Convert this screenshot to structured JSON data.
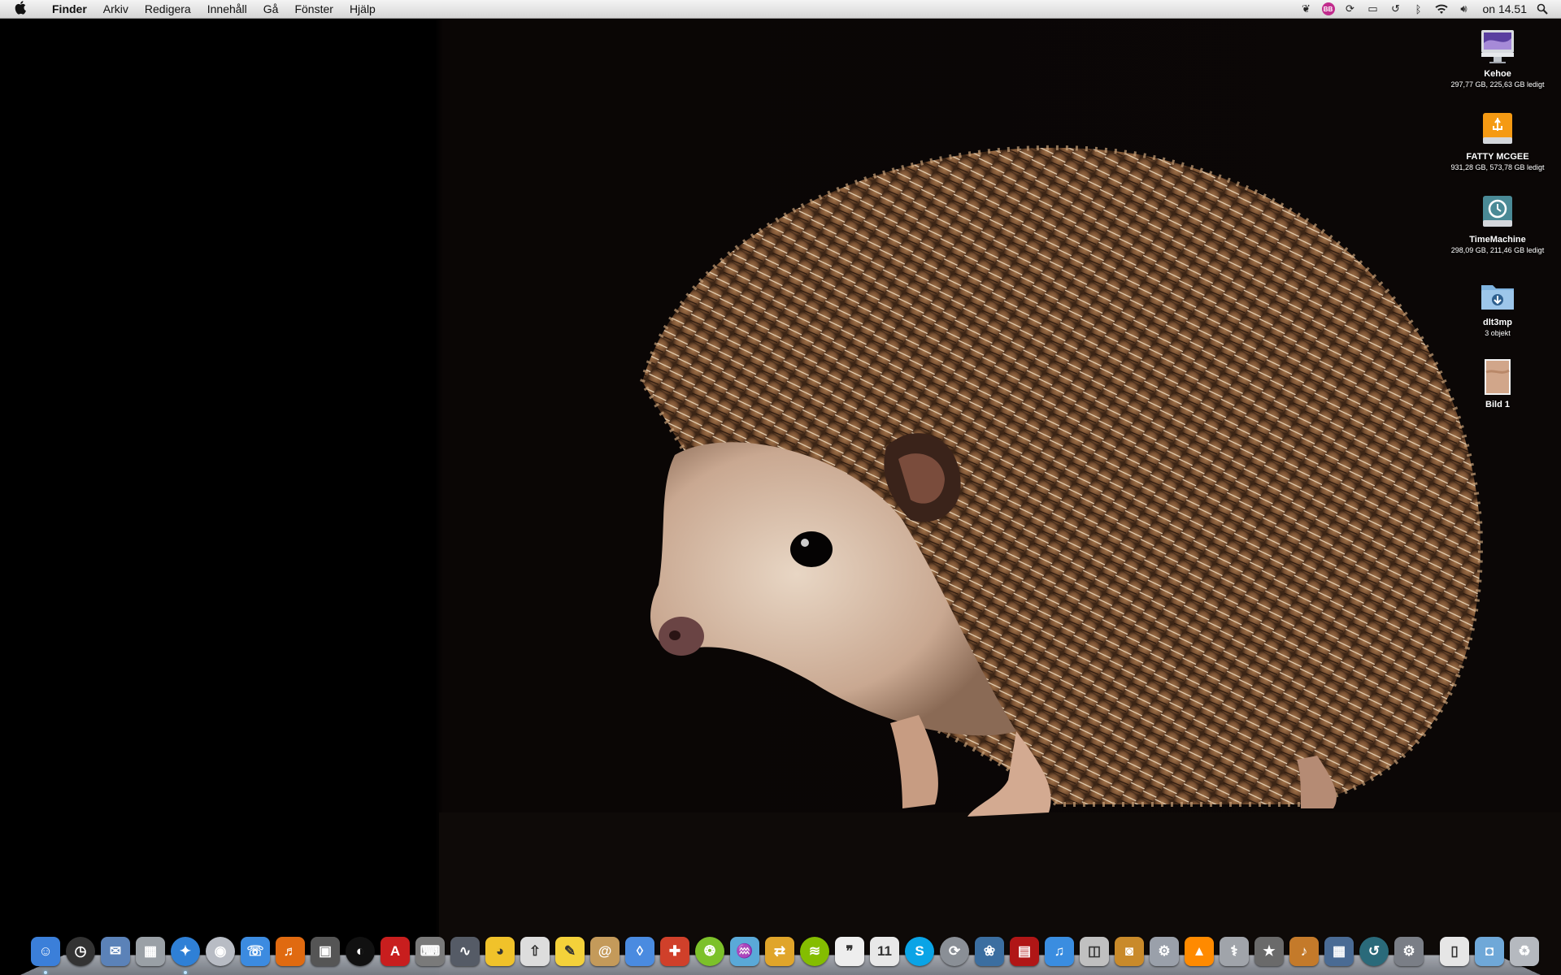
{
  "menubar": {
    "app_name": "Finder",
    "items": [
      "Arkiv",
      "Redigera",
      "Innehåll",
      "Gå",
      "Fönster",
      "Hjälp"
    ],
    "status_badge_text": "BB",
    "clock": "on 14.51"
  },
  "desktop_icons": [
    {
      "name": "Kehoe",
      "info": "297,77 GB, 225,63 GB ledigt",
      "icon": "imac-icon"
    },
    {
      "name": "FATTY MCGEE",
      "info": "931,28 GB, 573,78 GB ledigt",
      "icon": "usb-drive-icon"
    },
    {
      "name": "TimeMachine",
      "info": "298,09 GB, 211,46 GB ledigt",
      "icon": "time-machine-drive-icon"
    },
    {
      "name": "dlt3mp",
      "info": "3 objekt",
      "icon": "downloads-folder-icon"
    },
    {
      "name": "Bild 1",
      "info": "",
      "icon": "image-thumbnail-icon"
    }
  ],
  "dock": {
    "apps": [
      {
        "icon": "finder-icon",
        "glyph": "☺",
        "color": "#3b7fd9"
      },
      {
        "icon": "dashboard-icon",
        "glyph": "◷",
        "color": "#333333"
      },
      {
        "icon": "mail-icon",
        "glyph": "✉",
        "color": "#5b82b8"
      },
      {
        "icon": "calculator-icon",
        "glyph": "▦",
        "color": "#9aa0a6"
      },
      {
        "icon": "safari-icon",
        "glyph": "✦",
        "color": "#2f80d6"
      },
      {
        "icon": "dvd-player-icon",
        "glyph": "◉",
        "color": "#b8bcc4"
      },
      {
        "icon": "ichat-icon",
        "glyph": "☏",
        "color": "#3c8be0"
      },
      {
        "icon": "audacity-icon",
        "glyph": "♬",
        "color": "#e06a10"
      },
      {
        "icon": "film-icon",
        "glyph": "▣",
        "color": "#555555"
      },
      {
        "icon": "ableton-live-icon",
        "glyph": "◐",
        "color": "#111111"
      },
      {
        "icon": "automap-icon",
        "glyph": "A",
        "color": "#c81e1e"
      },
      {
        "icon": "keyboard-icon",
        "glyph": "⌨",
        "color": "#7a7a7a"
      },
      {
        "icon": "wave-icon",
        "glyph": "∿",
        "color": "#555b66"
      },
      {
        "icon": "cyberduck-icon",
        "glyph": "◕",
        "color": "#f0c22a"
      },
      {
        "icon": "flickr-uploadr-icon",
        "glyph": "⇧",
        "color": "#dddddd"
      },
      {
        "icon": "stickies-icon",
        "glyph": "✎",
        "color": "#f4d13a"
      },
      {
        "icon": "address-book-icon",
        "glyph": "@",
        "color": "#c49a5a"
      },
      {
        "icon": "bottle-icon",
        "glyph": "◊",
        "color": "#4a8be0"
      },
      {
        "icon": "hair-dryer-icon",
        "glyph": "✚",
        "color": "#d0402a"
      },
      {
        "icon": "lime-icon",
        "glyph": "❂",
        "color": "#7cc12a"
      },
      {
        "icon": "fish-icon",
        "glyph": "♒",
        "color": "#5aa9d8"
      },
      {
        "icon": "folder-sync-icon",
        "glyph": "⇄",
        "color": "#e0a52a"
      },
      {
        "icon": "spotify-icon",
        "glyph": "≋",
        "color": "#84bd00"
      },
      {
        "icon": "speech-bubble-icon",
        "glyph": "❞",
        "color": "#eeeeee"
      },
      {
        "icon": "ical-icon",
        "glyph": "11",
        "color": "#e8e8e8"
      },
      {
        "icon": "skype-icon",
        "glyph": "S",
        "color": "#0aa4e6"
      },
      {
        "icon": "sync-icon",
        "glyph": "⟳",
        "color": "#8a8f96"
      },
      {
        "icon": "iphoto-icon",
        "glyph": "❀",
        "color": "#3b6ea0"
      },
      {
        "icon": "photo-booth-icon",
        "glyph": "▤",
        "color": "#b01616"
      },
      {
        "icon": "itunes-icon",
        "glyph": "♫",
        "color": "#3a8de0"
      },
      {
        "icon": "preview-icon",
        "glyph": "◫",
        "color": "#c0c0c0"
      },
      {
        "icon": "image-capture-icon",
        "glyph": "◙",
        "color": "#c98a2a"
      },
      {
        "icon": "automator-icon",
        "glyph": "⚙",
        "color": "#9aa0aa"
      },
      {
        "icon": "vlc-icon",
        "glyph": "▲",
        "color": "#ff8a00"
      },
      {
        "icon": "disk-utility-icon",
        "glyph": "⚕",
        "color": "#a0a4aa"
      },
      {
        "icon": "imovie-icon",
        "glyph": "★",
        "color": "#6a6a6a"
      },
      {
        "icon": "garageband-icon",
        "glyph": "♪",
        "color": "#c47a2a"
      },
      {
        "icon": "expose-icon",
        "glyph": "▦",
        "color": "#4a6b94"
      },
      {
        "icon": "time-machine-icon",
        "glyph": "↺",
        "color": "#2a6a7a"
      },
      {
        "icon": "system-preferences-icon",
        "glyph": "⚙",
        "color": "#7a7e86"
      }
    ],
    "docs": [
      {
        "icon": "document-stack-icon",
        "glyph": "▯",
        "color": "#e6e6e6"
      },
      {
        "icon": "camera-folder-icon",
        "glyph": "◘",
        "color": "#6fa8d8"
      },
      {
        "icon": "trash-icon",
        "glyph": "♻",
        "color": "#b5b9bf"
      }
    ]
  }
}
